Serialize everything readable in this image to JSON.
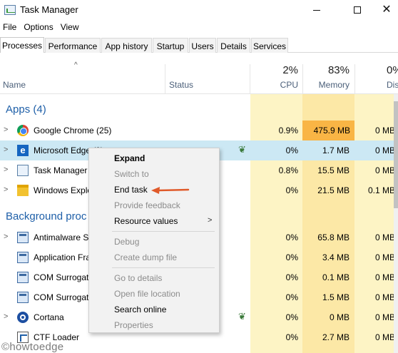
{
  "window": {
    "title": "Task Manager"
  },
  "menu": [
    "File",
    "Options",
    "View"
  ],
  "tabs": [
    "Processes",
    "Performance",
    "App history",
    "Startup",
    "Users",
    "Details",
    "Services"
  ],
  "columns": {
    "name": "Name",
    "status": "Status",
    "cpu": {
      "pct": "2%",
      "label": "CPU"
    },
    "memory": {
      "pct": "83%",
      "label": "Memory"
    },
    "disk": {
      "pct": "0%",
      "label": "Dis"
    }
  },
  "groups": {
    "apps": "Apps (4)",
    "background": "Background proc"
  },
  "rows": [
    {
      "name": "Google Chrome (25)",
      "cpu": "0.9%",
      "memory": "475.9 MB",
      "disk": "0 MB,"
    },
    {
      "name": "Microsoft Edge (9)",
      "cpu": "0%",
      "memory": "1.7 MB",
      "disk": "0 MB,"
    },
    {
      "name": "Task Manager",
      "cpu": "0.8%",
      "memory": "15.5 MB",
      "disk": "0 MB,"
    },
    {
      "name": "Windows Explo",
      "cpu": "0%",
      "memory": "21.5 MB",
      "disk": "0.1 MB,"
    },
    {
      "name": "Antimalware S",
      "cpu": "0%",
      "memory": "65.8 MB",
      "disk": "0 MB,"
    },
    {
      "name": "Application Fra",
      "cpu": "0%",
      "memory": "3.4 MB",
      "disk": "0 MB,"
    },
    {
      "name": "COM Surrogat",
      "cpu": "0%",
      "memory": "0.1 MB",
      "disk": "0 MB,"
    },
    {
      "name": "COM Surrogat",
      "cpu": "0%",
      "memory": "1.5 MB",
      "disk": "0 MB,"
    },
    {
      "name": "Cortana",
      "cpu": "0%",
      "memory": "0 MB",
      "disk": "0 MB,"
    },
    {
      "name": "CTF Loader",
      "cpu": "0%",
      "memory": "2.7 MB",
      "disk": "0 MB,"
    }
  ],
  "context_menu": [
    "Expand",
    "Switch to",
    "End task",
    "Provide feedback",
    "Resource values",
    "Debug",
    "Create dump file",
    "Go to details",
    "Open file location",
    "Search online",
    "Properties"
  ],
  "watermark": "©howtoedge",
  "colors": {
    "accent": "#1e5fa8",
    "selected": "#cce8f4",
    "cpu_bg": "#fdf4c5",
    "mem_bg": "#fce8a6",
    "mem_hot": "#f9b545",
    "arrow": "#e05a2a"
  }
}
